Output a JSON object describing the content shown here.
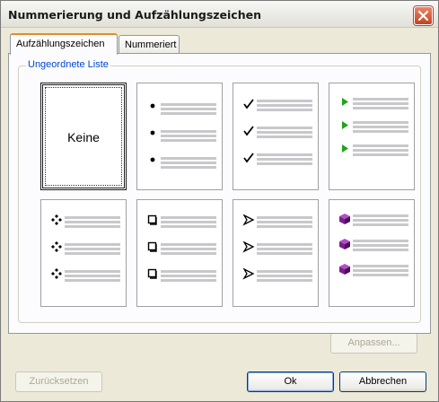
{
  "window": {
    "title": "Nummerierung und Aufzählungszeichen"
  },
  "tabs": [
    {
      "label": "Aufzählungszeichen",
      "active": true
    },
    {
      "label": "Nummeriert",
      "active": false
    }
  ],
  "group": {
    "legend": "Ungeordnete Liste",
    "options": [
      {
        "id": "none",
        "label": "Keine",
        "selected": true
      },
      {
        "id": "dot",
        "icon": "dot-bullet-icon"
      },
      {
        "id": "check",
        "icon": "checkmark-bullet-icon"
      },
      {
        "id": "arrow",
        "icon": "green-triangle-bullet-icon"
      },
      {
        "id": "diamond",
        "icon": "four-diamond-bullet-icon"
      },
      {
        "id": "square",
        "icon": "square-bullet-icon"
      },
      {
        "id": "arrowhead",
        "icon": "arrowhead-bullet-icon"
      },
      {
        "id": "book",
        "icon": "purple-book-bullet-icon"
      }
    ]
  },
  "buttons": {
    "customize": "Anpassen...",
    "reset": "Zurücksetzen",
    "ok": "Ok",
    "cancel": "Abbrechen"
  },
  "colors": {
    "tab_accent": "#e68b2c",
    "legend_text": "#0046d5",
    "arrow_bullet": "#22a31a",
    "book_bullet": "#7a1f8c"
  }
}
